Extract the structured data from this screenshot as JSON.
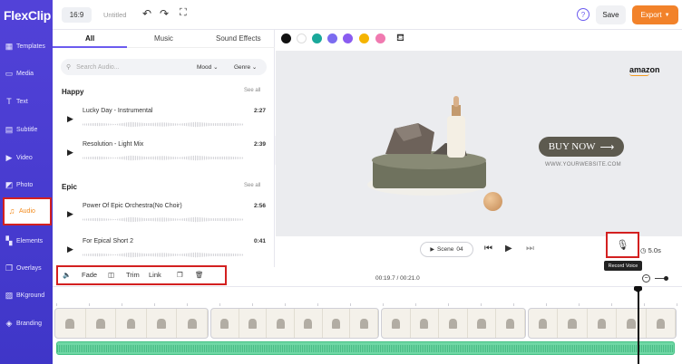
{
  "app": {
    "logo": "FlexClip"
  },
  "sidebar": {
    "items": [
      {
        "label": "Templates",
        "icon": "templates-icon"
      },
      {
        "label": "Media",
        "icon": "media-icon"
      },
      {
        "label": "Text",
        "icon": "text-icon"
      },
      {
        "label": "Subtitle",
        "icon": "subtitle-icon"
      },
      {
        "label": "Video",
        "icon": "video-icon"
      },
      {
        "label": "Photo",
        "icon": "photo-icon"
      },
      {
        "label": "Audio",
        "icon": "music-note-icon",
        "active": true
      },
      {
        "label": "Elements",
        "icon": "elements-icon"
      },
      {
        "label": "Overlays",
        "icon": "overlays-icon"
      },
      {
        "label": "BKground",
        "icon": "background-icon"
      },
      {
        "label": "Branding",
        "icon": "branding-icon"
      }
    ]
  },
  "topbar": {
    "ratio": "16:9",
    "title": "Untitled",
    "save_label": "Save",
    "export_label": "Export",
    "help_symbol": "?"
  },
  "audio_panel": {
    "tabs": [
      {
        "label": "All",
        "active": true
      },
      {
        "label": "Music"
      },
      {
        "label": "Sound Effects"
      }
    ],
    "search_placeholder": "Search Audio...",
    "mood_label": "Mood",
    "genre_label": "Genre",
    "groups": [
      {
        "title": "Happy",
        "see_all": "See all",
        "tracks": [
          {
            "name": "Lucky Day - Instrumental",
            "duration": "2:27"
          },
          {
            "name": "Resolution - Light Mix",
            "duration": "2:39"
          }
        ]
      },
      {
        "title": "Epic",
        "see_all": "See all",
        "tracks": [
          {
            "name": "Power Of Epic Orchestra(No Choir)",
            "duration": "2:56"
          },
          {
            "name": "For Epical Short 2",
            "duration": "0:41"
          }
        ]
      }
    ]
  },
  "palette": {
    "colors": [
      "#111111",
      "#ffffff",
      "#1aa89a",
      "#7b6cf0",
      "#8a5cf0",
      "#f5b400",
      "#f07ab0"
    ]
  },
  "canvas": {
    "brand": "amazon",
    "cta": "BUY NOW",
    "website": "WWW.YOURWEBSITE.COM"
  },
  "player": {
    "scene_label": "Scene",
    "scene_number": "04",
    "duration": "5.0s",
    "tooltip": "Record Voice"
  },
  "audio_tools": {
    "fade": "Fade",
    "trim": "Trim",
    "link": "Link"
  },
  "timeline": {
    "time_readout": "00:19.7 / 00:21.0"
  },
  "colors": {
    "sidebar": "#4b3fd6",
    "accent": "#6b5bef",
    "export": "#f2822a",
    "highlight": "#d32020",
    "audio_track": "#6fd7a5"
  }
}
